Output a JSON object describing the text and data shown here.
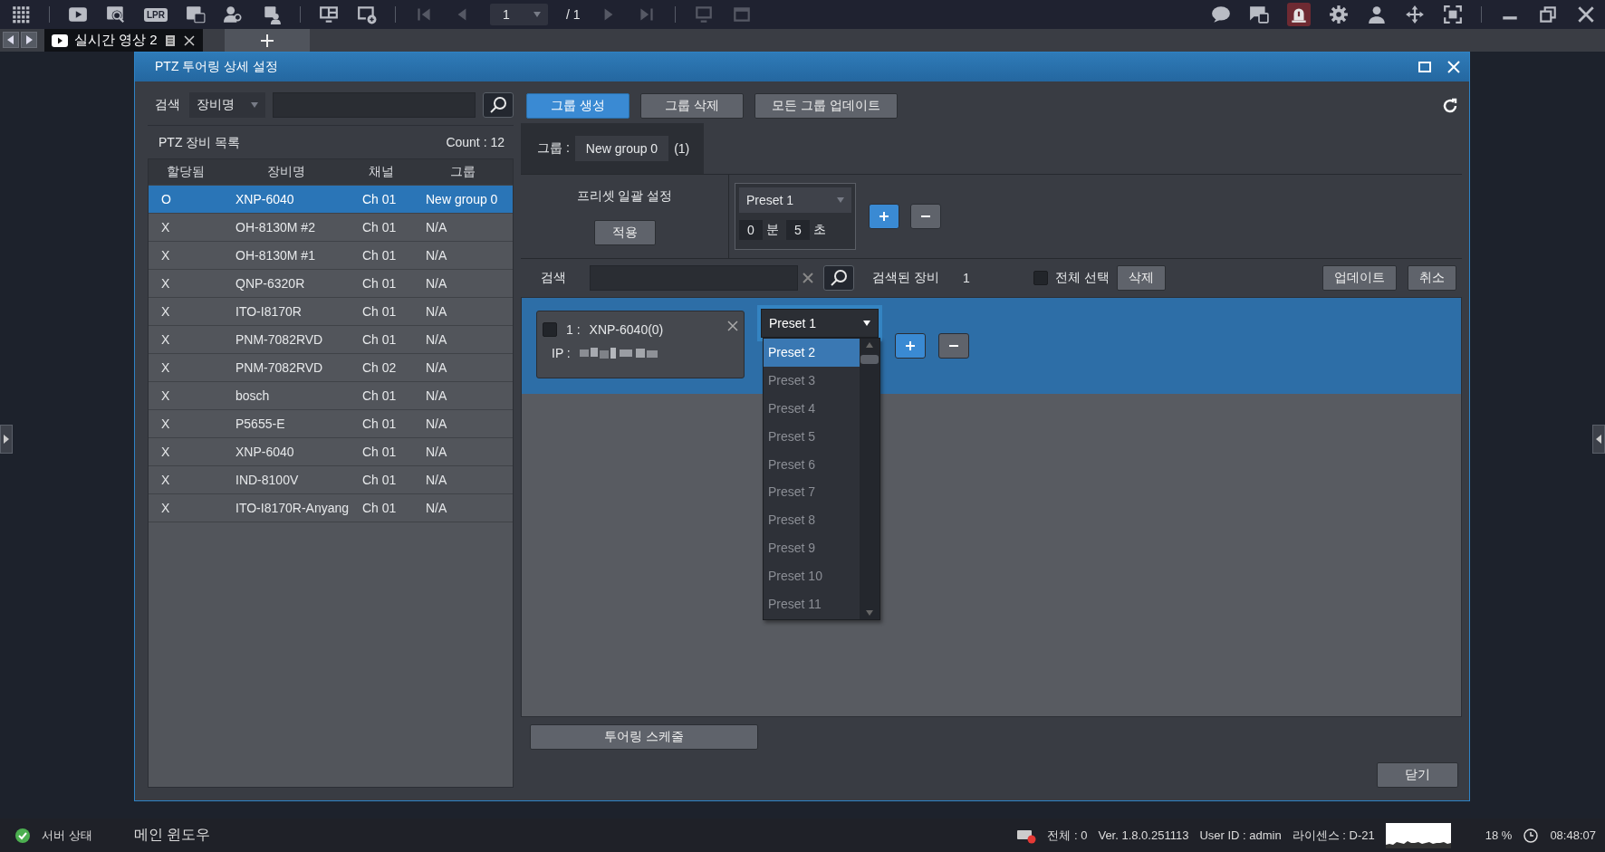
{
  "toolbar": {
    "lpr_label": "LPR",
    "page": "1",
    "total": "/ 1",
    "nav_disabled": true
  },
  "tabs": [
    {
      "label": "실시간 영상 2",
      "selected": true
    }
  ],
  "dialog": {
    "title": "PTZ 투어링 상세 설정",
    "left": {
      "search_label": "검색",
      "search_field": "장비명",
      "list_title": "PTZ 장비 목록",
      "count": "Count : 12",
      "columns": [
        "할당됨",
        "장비명",
        "채널",
        "그룹"
      ],
      "rows": [
        {
          "assigned": "O",
          "name": "XNP-6040",
          "channel": "Ch 01",
          "group": "New group 0",
          "selected": true
        },
        {
          "assigned": "X",
          "name": "OH-8130M #2",
          "channel": "Ch 01",
          "group": "N/A",
          "selected": false
        },
        {
          "assigned": "X",
          "name": "OH-8130M #1",
          "channel": "Ch 01",
          "group": "N/A",
          "selected": false
        },
        {
          "assigned": "X",
          "name": "QNP-6320R",
          "channel": "Ch 01",
          "group": "N/A",
          "selected": false
        },
        {
          "assigned": "X",
          "name": "ITO-I8170R",
          "channel": "Ch 01",
          "group": "N/A",
          "selected": false
        },
        {
          "assigned": "X",
          "name": "PNM-7082RVD",
          "channel": "Ch 01",
          "group": "N/A",
          "selected": false
        },
        {
          "assigned": "X",
          "name": "PNM-7082RVD",
          "channel": "Ch 02",
          "group": "N/A",
          "selected": false
        },
        {
          "assigned": "X",
          "name": "bosch",
          "channel": "Ch 01",
          "group": "N/A",
          "selected": false
        },
        {
          "assigned": "X",
          "name": "P5655-E",
          "channel": "Ch 01",
          "group": "N/A",
          "selected": false
        },
        {
          "assigned": "X",
          "name": "XNP-6040",
          "channel": "Ch 01",
          "group": "N/A",
          "selected": false
        },
        {
          "assigned": "X",
          "name": "IND-8100V",
          "channel": "Ch 01",
          "group": "N/A",
          "selected": false
        },
        {
          "assigned": "X",
          "name": "ITO-I8170R-Anyang",
          "channel": "Ch 01",
          "group": "N/A",
          "selected": false
        }
      ]
    },
    "group_buttons": [
      {
        "label": "그룹 생성",
        "kind": "primary"
      },
      {
        "label": "그룹 삭제",
        "kind": "normal"
      },
      {
        "label": "모든 그룹 업데이트",
        "kind": "normal"
      }
    ],
    "group_tabs": [
      {
        "prefix": "그룹 :",
        "name": "New group 0",
        "count": "(1)",
        "selected": true
      }
    ],
    "bulk": {
      "title": "프리셋 일괄 설정",
      "apply": "적용",
      "preset": "Preset 1",
      "minutes": "0",
      "min_unit": "분",
      "seconds": "5",
      "sec_unit": "초"
    },
    "filter": {
      "label": "검색",
      "found_label": "검색된 장비",
      "found": "1",
      "select_all": {
        "label": "전체 선택",
        "checked": false
      },
      "delete": "삭제",
      "update": "업데이트",
      "cancel": "취소"
    },
    "devices": [
      {
        "index": "1 :",
        "name": "XNP-6040(0)",
        "ip_label": "IP :",
        "checked": false,
        "preset": "Preset 1",
        "options": [
          {
            "label": "Preset 2",
            "selected": true
          },
          {
            "label": "Preset 3",
            "selected": false
          },
          {
            "label": "Preset 4",
            "selected": false
          },
          {
            "label": "Preset 5",
            "selected": false
          },
          {
            "label": "Preset 6",
            "selected": false
          },
          {
            "label": "Preset 7",
            "selected": false
          },
          {
            "label": "Preset 8",
            "selected": false
          },
          {
            "label": "Preset 9",
            "selected": false
          },
          {
            "label": "Preset 10",
            "selected": false
          },
          {
            "label": "Preset 11",
            "selected": false
          }
        ]
      }
    ],
    "schedule": "투어링 스케줄",
    "close": "닫기"
  },
  "status_bar": {
    "server": "서버 상태",
    "window": "메인 윈도우",
    "total": "전체 : 0",
    "version": "Ver. 1.8.0.251113",
    "user": "User ID : admin",
    "license": "라이센스 : D-21",
    "cpu": "18 %",
    "time": "08:48:07"
  }
}
